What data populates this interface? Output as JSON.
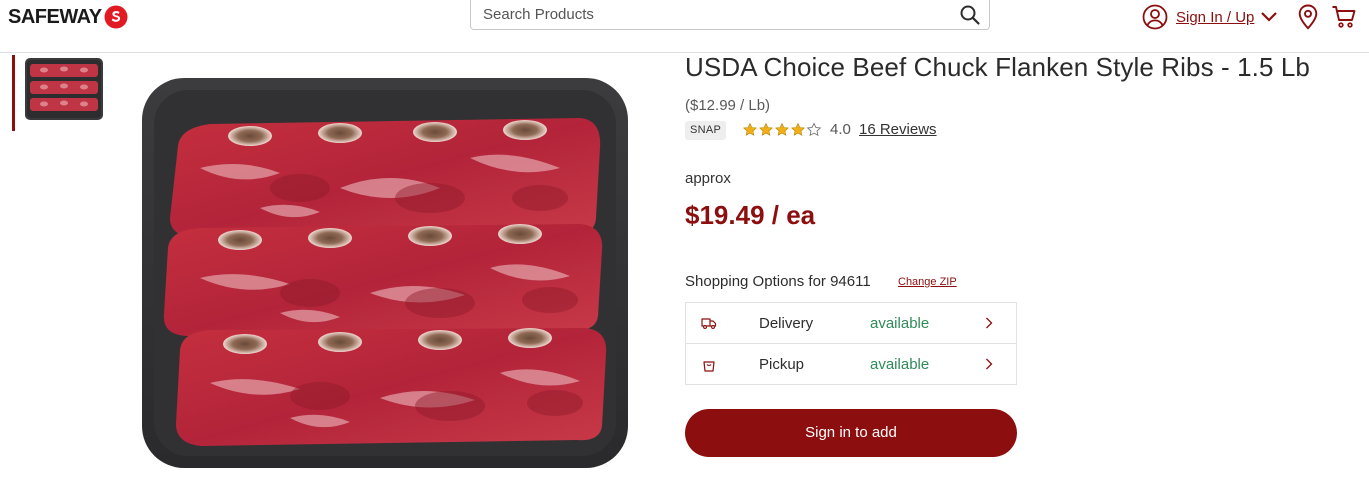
{
  "header": {
    "logo_text": "SAFEWAY",
    "search_placeholder": "Search Products",
    "account_label": "Sign In / Up",
    "brand_color": "#8c0e0e"
  },
  "gallery": {
    "thumbnail_count": 1,
    "icons": [
      "beef-tray-thumbnail",
      "beef-tray-main-image"
    ]
  },
  "product": {
    "title": "USDA Choice Beef Chuck Flanken Style Ribs - 1.5 Lb",
    "unit_price": "($12.99 / Lb)",
    "snap_badge": "SNAP",
    "rating": 4.0,
    "rating_text": "4.0",
    "rating_max": 5,
    "reviews_link": "16 Reviews",
    "approx_label": "approx",
    "price": "$19.49 / ea"
  },
  "shopping": {
    "options_label": "Shopping Options for 94611",
    "change_zip": "Change ZIP",
    "options": [
      {
        "label": "Delivery",
        "status": "available",
        "icon": "delivery-truck-icon"
      },
      {
        "label": "Pickup",
        "status": "available",
        "icon": "shopping-bag-icon"
      }
    ],
    "status_color": "#2e8b57"
  },
  "actions": {
    "signin_button": "Sign in to add"
  }
}
